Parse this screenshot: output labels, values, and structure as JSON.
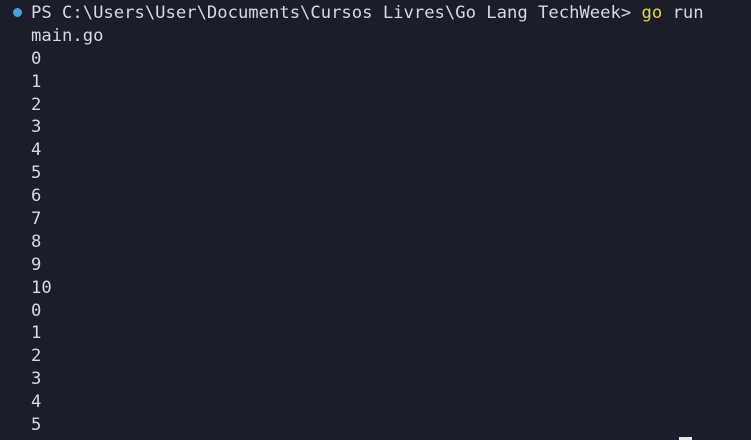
{
  "terminal": {
    "prompt": "PS C:\\Users\\User\\Documents\\Cursos Livres\\Go Lang TechWeek> ",
    "command_keyword": "go",
    "command_rest": " run",
    "command_continuation": "main.go",
    "output": [
      "0",
      "1",
      "2",
      "3",
      "4",
      "5",
      "6",
      "7",
      "8",
      "9",
      "10",
      "0",
      "1",
      "2",
      "3",
      "4",
      "5"
    ]
  },
  "colors": {
    "background": "#1b1d2a",
    "text": "#d6d9e4",
    "command": "#e8d44d",
    "status_dot": "#4a9fd4"
  }
}
